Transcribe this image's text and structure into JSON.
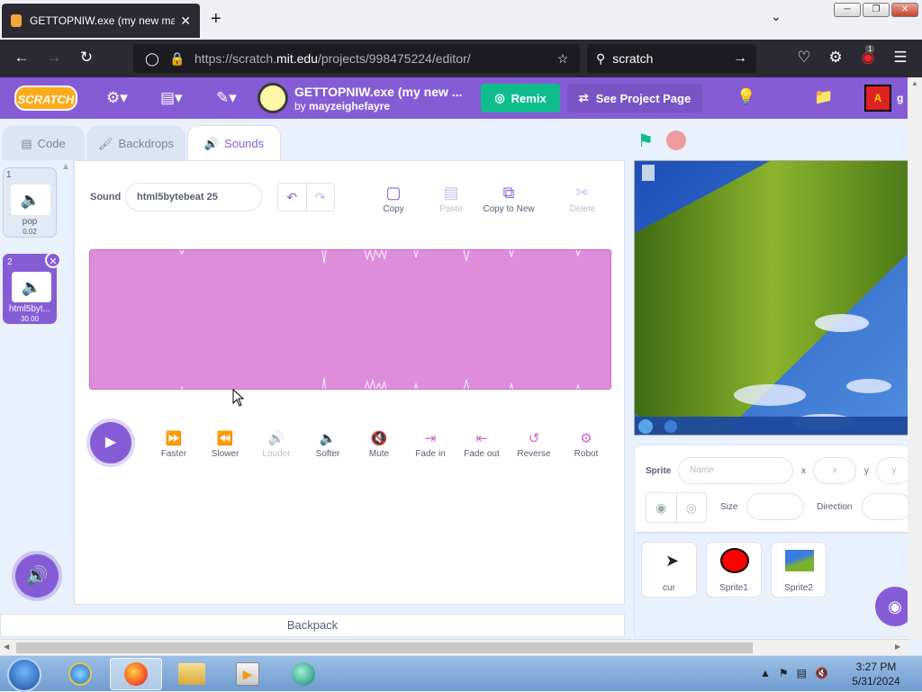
{
  "browser": {
    "tab_title": "GETTOPNIW.exe (my new malw",
    "tab_close": "✕",
    "new_tab": "+",
    "url_host_prefix": "https://scratch.",
    "url_host": "mit.edu",
    "url_path": "/projects/998475224/editor/",
    "search_text": "scratch",
    "extension_badge": "1"
  },
  "menu": {
    "logo": "SCRATCH",
    "project_title": "GETTOPNIW.exe (my new ...",
    "by": "by",
    "author": "mayzeighefayre",
    "remix": "Remix",
    "see_project_page": "See Project Page",
    "avatar_letter": "A",
    "username": "g"
  },
  "editor_tabs": [
    {
      "label": "Code"
    },
    {
      "label": "Backdrops"
    },
    {
      "label": "Sounds"
    }
  ],
  "sounds": [
    {
      "num": "1",
      "name": "pop",
      "duration": "0.02"
    },
    {
      "num": "2",
      "name": "html5byt...",
      "duration": "30.00"
    }
  ],
  "sound_editor": {
    "sound_label": "Sound",
    "sound_name": "html5bytebeat 25",
    "tools": [
      {
        "label": "Copy"
      },
      {
        "label": "Paste"
      },
      {
        "label": "Copy to New"
      },
      {
        "label": "Delete"
      }
    ],
    "effects": [
      {
        "label": "Faster"
      },
      {
        "label": "Slower"
      },
      {
        "label": "Louder"
      },
      {
        "label": "Softer"
      },
      {
        "label": "Mute"
      },
      {
        "label": "Fade in"
      },
      {
        "label": "Fade out"
      },
      {
        "label": "Reverse"
      },
      {
        "label": "Robot"
      }
    ],
    "waveform_color": "#de8ddd"
  },
  "backpack": "Backpack",
  "sprite_info": {
    "sprite_label": "Sprite",
    "name_placeholder": "Name",
    "x_label": "x",
    "x_placeholder": "x",
    "y_label": "y",
    "y_placeholder": "y",
    "size_label": "Size",
    "direction_label": "Direction"
  },
  "sprites": [
    {
      "name": "cur"
    },
    {
      "name": "Sprite1"
    },
    {
      "name": "Sprite2"
    }
  ],
  "taskbar": {
    "time": "3:27 PM",
    "date": "5/31/2024"
  },
  "colors": {
    "accent": "#855cd6",
    "remix": "#0fbd8c",
    "sound_effect_icon": "#cf63cf"
  }
}
